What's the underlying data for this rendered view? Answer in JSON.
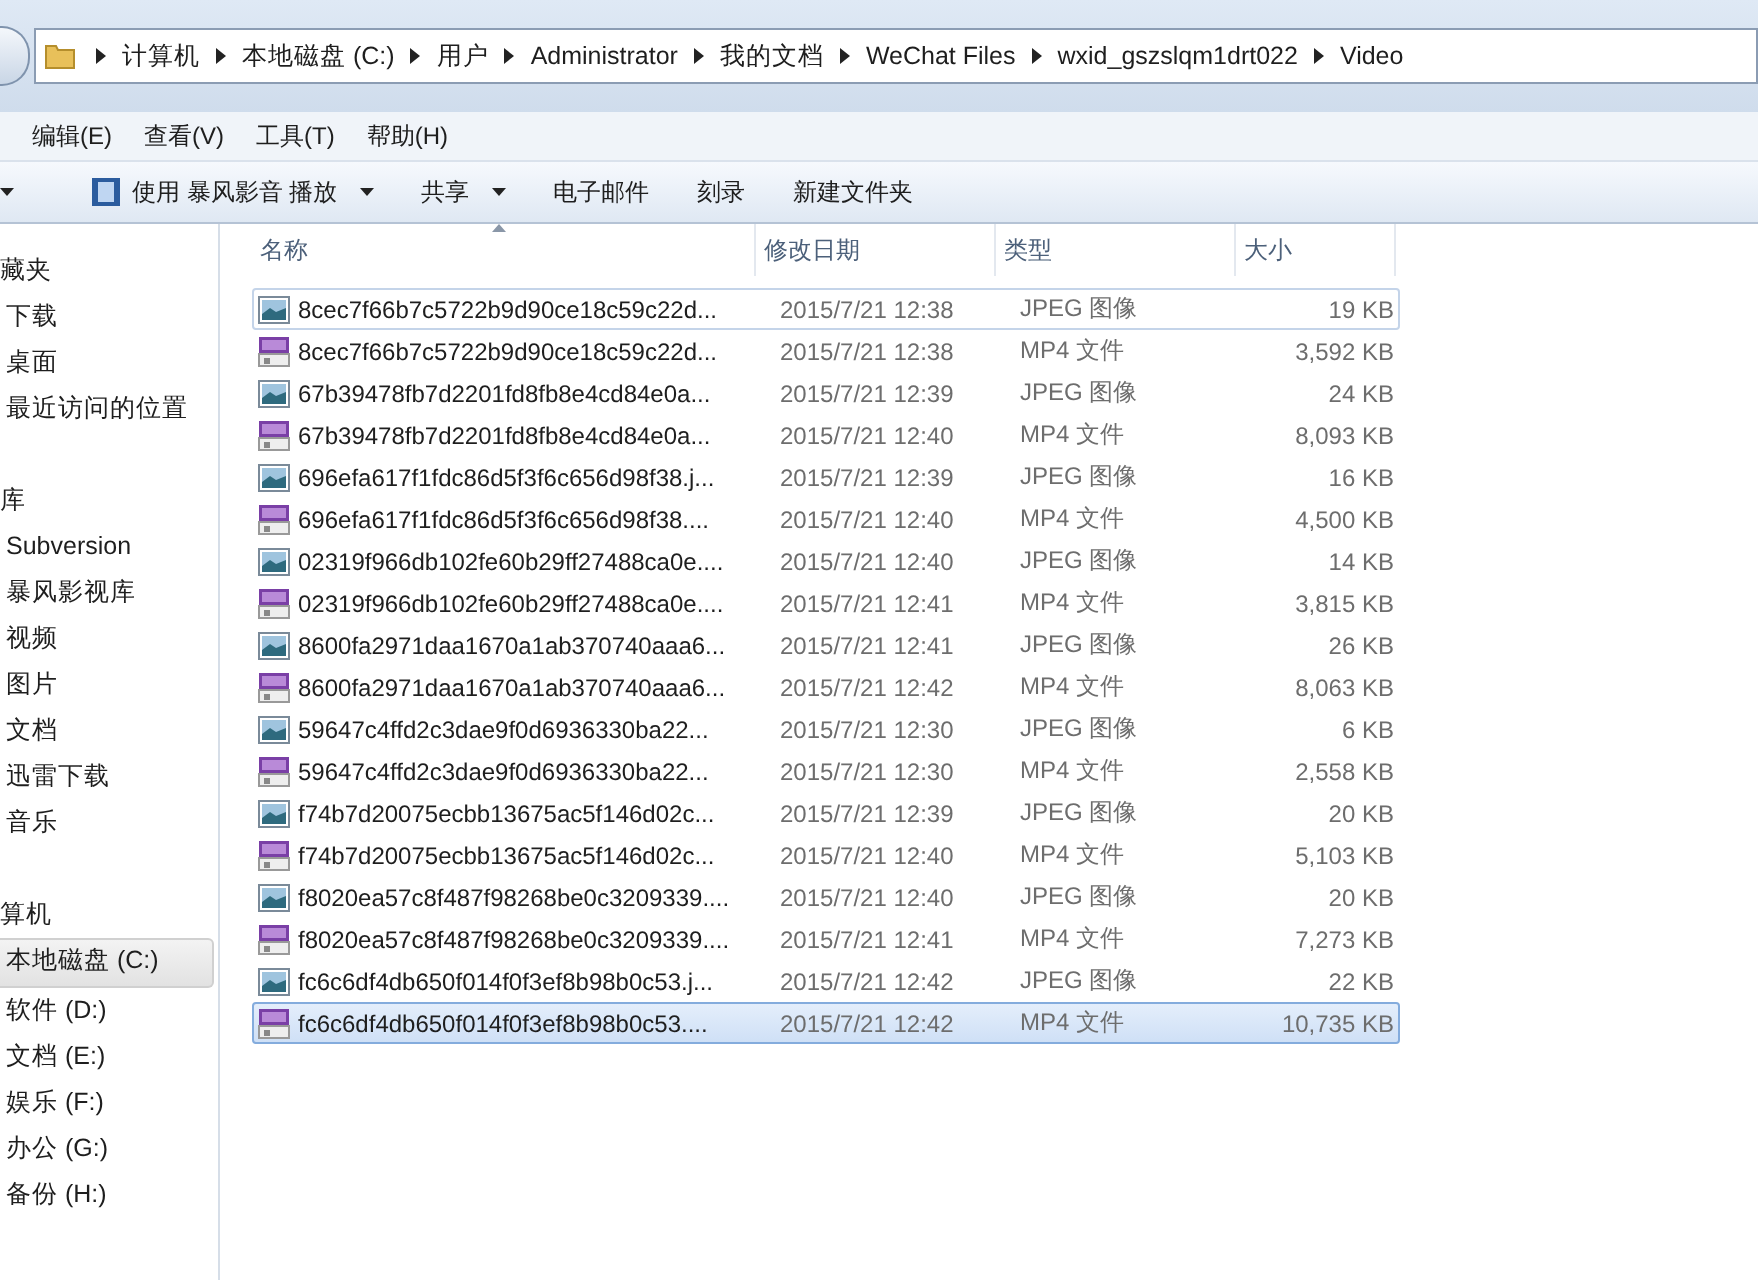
{
  "address_bar": {
    "path": [
      "计算机",
      "本地磁盘 (C:)",
      "用户",
      "Administrator",
      "我的文档",
      "WeChat Files",
      "wxid_gszslqm1drt022",
      "Video"
    ]
  },
  "menu_bar": [
    "编辑(E)",
    "查看(V)",
    "工具(T)",
    "帮助(H)"
  ],
  "toolbar": [
    {
      "label": "使用 暴风影音 播放",
      "kind": "play",
      "dropdown": true
    },
    {
      "label": "共享",
      "kind": "plain",
      "dropdown": true
    },
    {
      "label": "电子邮件",
      "kind": "plain",
      "dropdown": false
    },
    {
      "label": "刻录",
      "kind": "plain",
      "dropdown": false
    },
    {
      "label": "新建文件夹",
      "kind": "plain",
      "dropdown": false
    }
  ],
  "sidebar": {
    "groups": [
      {
        "title": "藏夹",
        "items": [
          {
            "label": "下载",
            "selected": false
          },
          {
            "label": "桌面",
            "selected": false
          },
          {
            "label": "最近访问的位置",
            "selected": false
          }
        ]
      },
      {
        "title": "库",
        "items": [
          {
            "label": "Subversion",
            "selected": false
          },
          {
            "label": "暴风影视库",
            "selected": false
          },
          {
            "label": "视频",
            "selected": false
          },
          {
            "label": "图片",
            "selected": false
          },
          {
            "label": "文档",
            "selected": false
          },
          {
            "label": "迅雷下载",
            "selected": false
          },
          {
            "label": "音乐",
            "selected": false
          }
        ]
      },
      {
        "title": "算机",
        "items": [
          {
            "label": "本地磁盘 (C:)",
            "selected": true
          },
          {
            "label": "软件 (D:)",
            "selected": false
          },
          {
            "label": "文档 (E:)",
            "selected": false
          },
          {
            "label": "娱乐 (F:)",
            "selected": false
          },
          {
            "label": "办公 (G:)",
            "selected": false
          },
          {
            "label": "备份 (H:)",
            "selected": false
          }
        ]
      }
    ]
  },
  "table": {
    "columns": [
      "名称",
      "修改日期",
      "类型",
      "大小"
    ],
    "rows": [
      {
        "kind": "image",
        "name": "8cec7f66b7c5722b9d90ce18c59c22d...",
        "date": "2015/7/21 12:38",
        "type": "JPEG 图像",
        "size": "19 KB",
        "focused": true,
        "selected": false
      },
      {
        "kind": "video",
        "name": "8cec7f66b7c5722b9d90ce18c59c22d...",
        "date": "2015/7/21 12:38",
        "type": "MP4 文件",
        "size": "3,592 KB",
        "focused": false,
        "selected": false
      },
      {
        "kind": "image",
        "name": "67b39478fb7d2201fd8fb8e4cd84e0a...",
        "date": "2015/7/21 12:39",
        "type": "JPEG 图像",
        "size": "24 KB",
        "focused": false,
        "selected": false
      },
      {
        "kind": "video",
        "name": "67b39478fb7d2201fd8fb8e4cd84e0a...",
        "date": "2015/7/21 12:40",
        "type": "MP4 文件",
        "size": "8,093 KB",
        "focused": false,
        "selected": false
      },
      {
        "kind": "image",
        "name": "696efa617f1fdc86d5f3f6c656d98f38.j...",
        "date": "2015/7/21 12:39",
        "type": "JPEG 图像",
        "size": "16 KB",
        "focused": false,
        "selected": false
      },
      {
        "kind": "video",
        "name": "696efa617f1fdc86d5f3f6c656d98f38....",
        "date": "2015/7/21 12:40",
        "type": "MP4 文件",
        "size": "4,500 KB",
        "focused": false,
        "selected": false
      },
      {
        "kind": "image",
        "name": "02319f966db102fe60b29ff27488ca0e....",
        "date": "2015/7/21 12:40",
        "type": "JPEG 图像",
        "size": "14 KB",
        "focused": false,
        "selected": false
      },
      {
        "kind": "video",
        "name": "02319f966db102fe60b29ff27488ca0e....",
        "date": "2015/7/21 12:41",
        "type": "MP4 文件",
        "size": "3,815 KB",
        "focused": false,
        "selected": false
      },
      {
        "kind": "image",
        "name": "8600fa2971daa1670a1ab370740aaa6...",
        "date": "2015/7/21 12:41",
        "type": "JPEG 图像",
        "size": "26 KB",
        "focused": false,
        "selected": false
      },
      {
        "kind": "video",
        "name": "8600fa2971daa1670a1ab370740aaa6...",
        "date": "2015/7/21 12:42",
        "type": "MP4 文件",
        "size": "8,063 KB",
        "focused": false,
        "selected": false
      },
      {
        "kind": "image",
        "name": "59647c4ffd2c3dae9f0d6936330ba22...",
        "date": "2015/7/21 12:30",
        "type": "JPEG 图像",
        "size": "6 KB",
        "focused": false,
        "selected": false
      },
      {
        "kind": "video",
        "name": "59647c4ffd2c3dae9f0d6936330ba22...",
        "date": "2015/7/21 12:30",
        "type": "MP4 文件",
        "size": "2,558 KB",
        "focused": false,
        "selected": false
      },
      {
        "kind": "image",
        "name": "f74b7d20075ecbb13675ac5f146d02c...",
        "date": "2015/7/21 12:39",
        "type": "JPEG 图像",
        "size": "20 KB",
        "focused": false,
        "selected": false
      },
      {
        "kind": "video",
        "name": "f74b7d20075ecbb13675ac5f146d02c...",
        "date": "2015/7/21 12:40",
        "type": "MP4 文件",
        "size": "5,103 KB",
        "focused": false,
        "selected": false
      },
      {
        "kind": "image",
        "name": "f8020ea57c8f487f98268be0c3209339....",
        "date": "2015/7/21 12:40",
        "type": "JPEG 图像",
        "size": "20 KB",
        "focused": false,
        "selected": false
      },
      {
        "kind": "video",
        "name": "f8020ea57c8f487f98268be0c3209339....",
        "date": "2015/7/21 12:41",
        "type": "MP4 文件",
        "size": "7,273 KB",
        "focused": false,
        "selected": false
      },
      {
        "kind": "image",
        "name": "fc6c6df4db650f014f0f3ef8b98b0c53.j...",
        "date": "2015/7/21 12:42",
        "type": "JPEG 图像",
        "size": "22 KB",
        "focused": false,
        "selected": false
      },
      {
        "kind": "video",
        "name": "fc6c6df4db650f014f0f3ef8b98b0c53....",
        "date": "2015/7/21 12:42",
        "type": "MP4 文件",
        "size": "10,735 KB",
        "focused": false,
        "selected": true
      }
    ]
  }
}
